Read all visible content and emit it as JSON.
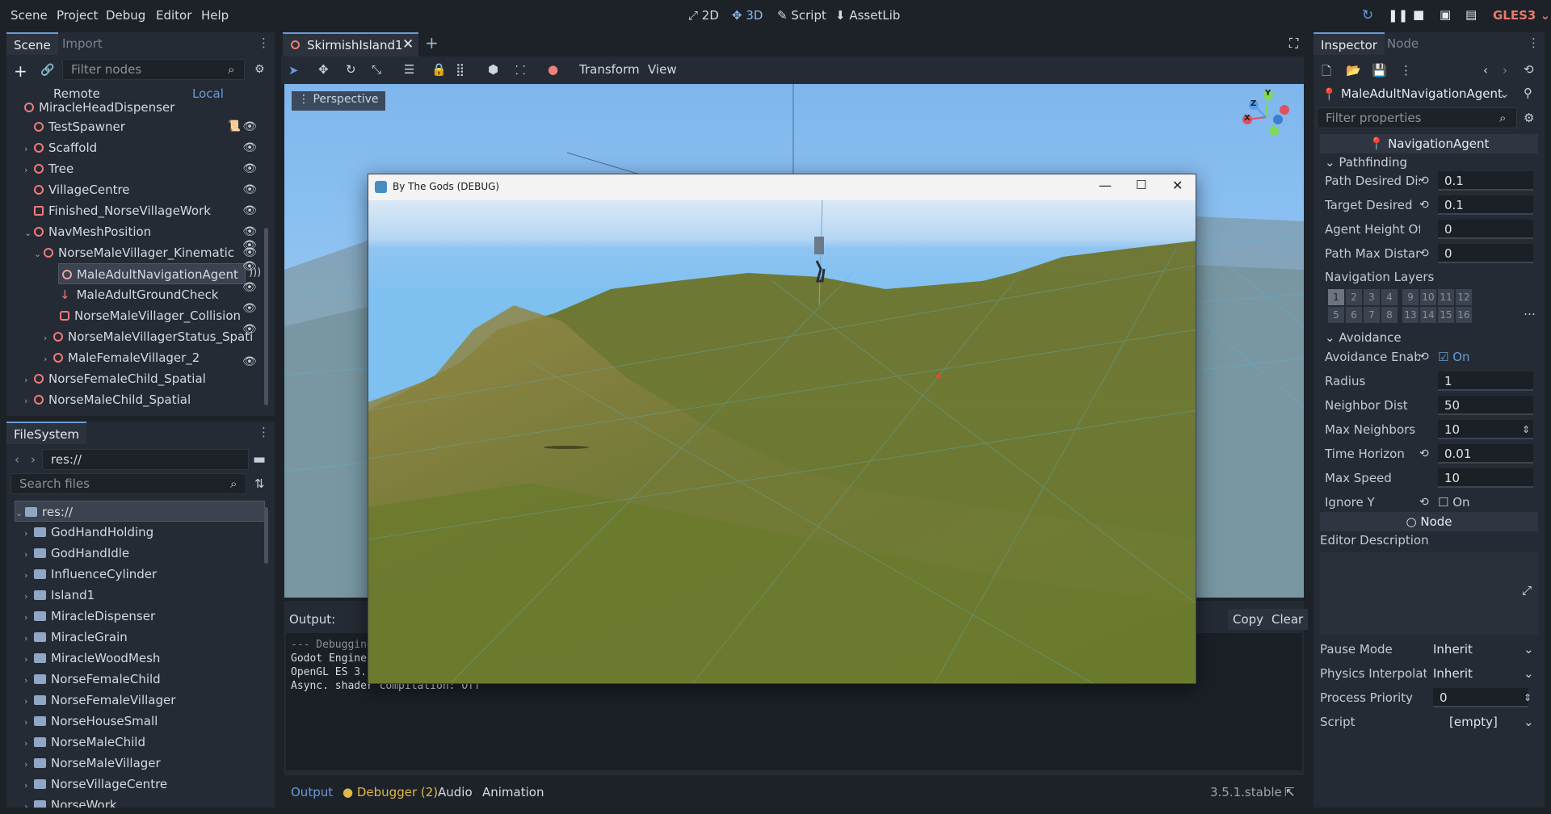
{
  "menu": [
    "Scene",
    "Project",
    "Debug",
    "Editor",
    "Help"
  ],
  "modes": {
    "m2d": "2D",
    "m3d": "3D",
    "script": "Script",
    "assetlib": "AssetLib"
  },
  "renderer": "GLES3",
  "scene_dock": {
    "tabs": [
      "Scene",
      "Import"
    ],
    "filter_placeholder": "Filter nodes",
    "remote": "Remote",
    "local": "Local",
    "nodes": [
      "MiracleHeadDispenser",
      "TestSpawner",
      "Scaffold",
      "Tree",
      "VillageCentre",
      "Finished_NorseVillageWork",
      "NavMeshPosition",
      "NorseMaleVillager_Kinematic",
      "MaleAdultNavigationAgent",
      "MaleAdultGroundCheck",
      "NorseMaleVillager_Collision",
      "NorseMaleVillagerStatus_Spati",
      "MaleFemaleVillager_2",
      "NorseFemaleChild_Spatial",
      "NorseMaleChild_Spatial"
    ]
  },
  "filesystem": {
    "title": "FileSystem",
    "path": "res://",
    "search_placeholder": "Search files",
    "root": "res://",
    "folders": [
      "GodHandHolding",
      "GodHandIdle",
      "InfluenceCylinder",
      "Island1",
      "MiracleDispenser",
      "MiracleGrain",
      "MiracleWoodMesh",
      "NorseFemaleChild",
      "NorseFemaleVillager",
      "NorseHouseSmall",
      "NorseMaleChild",
      "NorseMaleVillager",
      "NorseVillageCentre",
      "NorseWork"
    ]
  },
  "editor": {
    "scene_tab": "SkirmishIsland1",
    "toolbar": {
      "transform": "Transform",
      "view": "View"
    },
    "perspective": "Perspective",
    "gizmo": {
      "x": "X",
      "y": "Y",
      "z": "Z"
    }
  },
  "game_window": {
    "title": "By The Gods (DEBUG)"
  },
  "output": {
    "label": "Output:",
    "copy": "Copy",
    "clear": "Clear",
    "lines": [
      "--- Debugging",
      "Godot Engine",
      "OpenGL ES 3.",
      "Async. shader compilation: Off"
    ]
  },
  "bottom_tabs": {
    "output": "Output",
    "debugger": "Debugger (2)",
    "audio": "Audio",
    "animation": "Animation"
  },
  "version": "3.5.1.stable",
  "inspector": {
    "tabs": [
      "Inspector",
      "Node"
    ],
    "node_name": "MaleAdultNavigationAgent",
    "filter_placeholder": "Filter properties",
    "class_header": "NavigationAgent",
    "pathfinding": "Pathfinding",
    "props1": [
      {
        "label": "Path Desired Dis",
        "value": "0.1"
      },
      {
        "label": "Target Desired",
        "value": "0.1"
      },
      {
        "label": "Agent Height Offs",
        "value": "0"
      },
      {
        "label": "Path Max Distan",
        "value": "0"
      }
    ],
    "nav_layers_label": "Navigation Layers",
    "layers_row1": [
      "1",
      "2",
      "3",
      "4",
      "9",
      "10",
      "11",
      "12"
    ],
    "layers_row2": [
      "5",
      "6",
      "7",
      "8",
      "13",
      "14",
      "15",
      "16"
    ],
    "avoidance": "Avoidance",
    "avoid_enabled_label": "Avoidance Enabl",
    "avoid_enabled_value": "On",
    "props2": [
      {
        "label": "Radius",
        "value": "1"
      },
      {
        "label": "Neighbor Dist",
        "value": "50"
      },
      {
        "label": "Max Neighbors",
        "value": "10"
      },
      {
        "label": "Time Horizon",
        "value": "0.01"
      },
      {
        "label": "Max Speed",
        "value": "10"
      }
    ],
    "ignore_y_label": "Ignore Y",
    "ignore_y_value": "On",
    "node_header": "Node",
    "editor_description": "Editor Description",
    "props3": [
      {
        "label": "Pause Mode",
        "value": "Inherit"
      },
      {
        "label": "Physics Interpolati",
        "value": "Inherit"
      },
      {
        "label": "Process Priority",
        "value": "0"
      },
      {
        "label": "Script",
        "value": "[empty]"
      }
    ]
  },
  "colors": {
    "accent": "#6a9ad9",
    "bg": "#1d2229",
    "panel": "#252b34",
    "sky": "#8cc1f2",
    "terrain": "#6f7b32"
  }
}
